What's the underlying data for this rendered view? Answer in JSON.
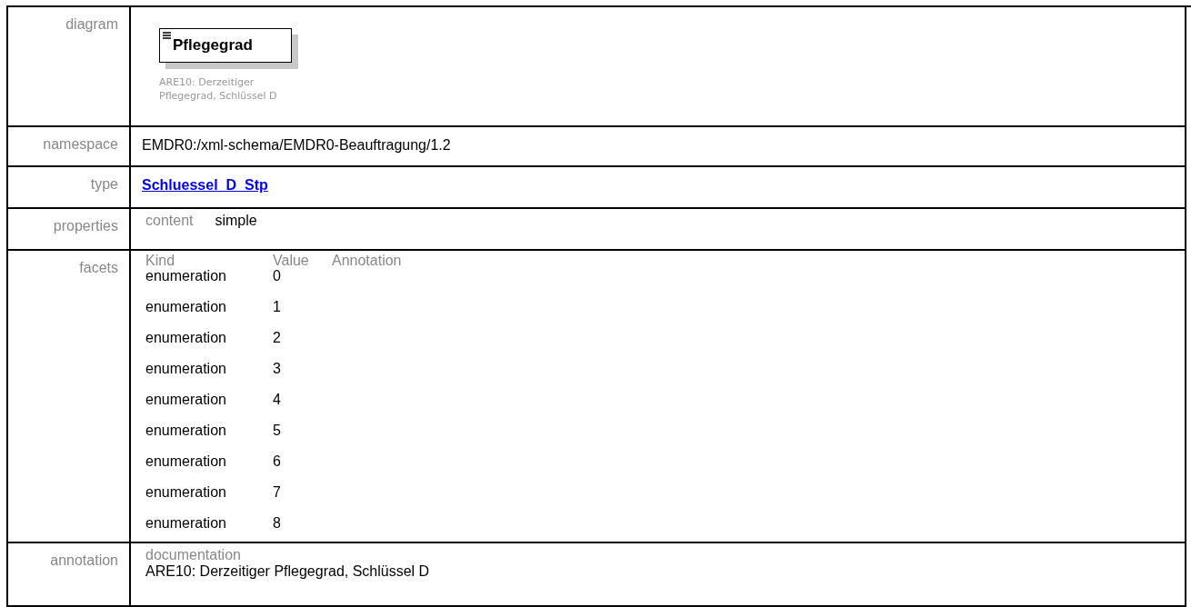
{
  "diagram": {
    "label": "diagram",
    "element": "Pflegegrad",
    "caption": [
      "ARE10: Derzeitiger",
      "Pflegegrad, Schlüssel D"
    ]
  },
  "namespace": {
    "label": "namespace",
    "value": "EMDR0:/xml-schema/EMDR0-Beauftragung/1.2"
  },
  "type": {
    "label": "type",
    "value": "Schluessel_D_Stp"
  },
  "properties": {
    "label": "properties",
    "key": "content",
    "value": "simple"
  },
  "facets": {
    "label": "facets",
    "columns": [
      "Kind",
      "Value",
      "Annotation"
    ],
    "rows": [
      {
        "kind": "enumeration",
        "value": "0"
      },
      {
        "kind": "enumeration",
        "value": "1"
      },
      {
        "kind": "enumeration",
        "value": "2"
      },
      {
        "kind": "enumeration",
        "value": "3"
      },
      {
        "kind": "enumeration",
        "value": "4"
      },
      {
        "kind": "enumeration",
        "value": "5"
      },
      {
        "kind": "enumeration",
        "value": "6"
      },
      {
        "kind": "enumeration",
        "value": "7"
      },
      {
        "kind": "enumeration",
        "value": "8"
      }
    ]
  },
  "annotation": {
    "label": "annotation",
    "heading": "documentation",
    "text": "ARE10: Derzeitiger Pflegegrad, Schlüssel D"
  }
}
